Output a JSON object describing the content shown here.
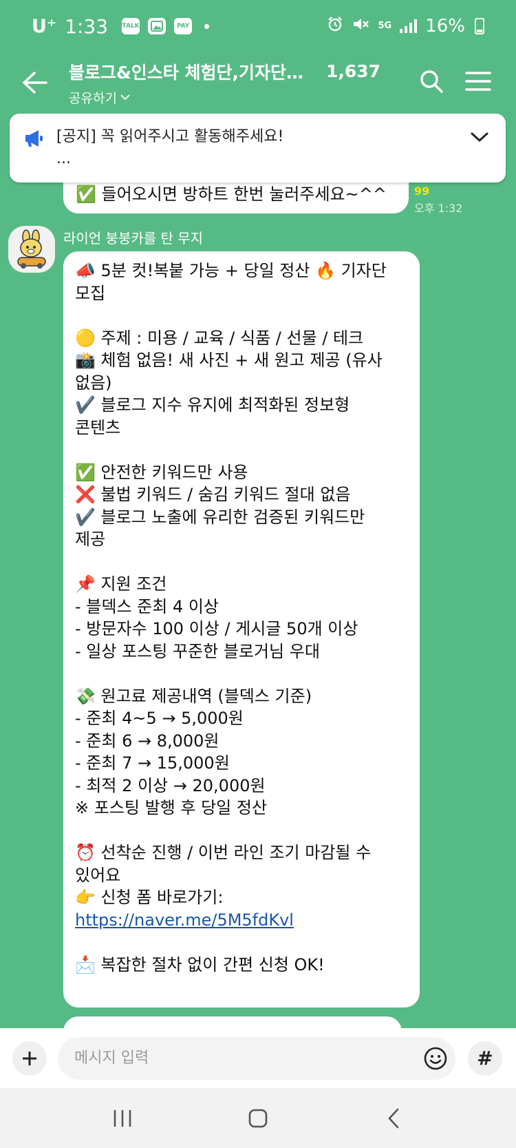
{
  "status_bar": {
    "carrier": "U⁺",
    "time": "1:33",
    "notif_icons": [
      "talk-icon",
      "gallery-icon",
      "pay-icon"
    ],
    "notif_talk_label": "TALK",
    "notif_pay_label": "PAY",
    "network": "5G",
    "battery": "16%"
  },
  "header": {
    "title": "블로그&인스타 체험단,기자단모집",
    "member_count": "1,637",
    "share_label": "공유하기"
  },
  "notice": {
    "text": "[공지] 꼭 읽어주시고 활동해주세요!",
    "ellipsis": "..."
  },
  "previous_message": {
    "text": "✅ 들어오시면 방하트 한번 눌러주세요~^^",
    "unread_count": "99",
    "time": "오후 1:32"
  },
  "sender": {
    "name": "라이언 붕붕카를 탄 무지"
  },
  "message": {
    "lines": [
      "📣 5분 컷!복붙 가능 + 당일 정산 🔥 기자단",
      "모집",
      "",
      "🟡 주제 : 미용 / 교육 / 식품 / 선물 / 테크",
      "📸 체험 없음! 새 사진 + 새 원고 제공 (유사",
      "없음)",
      "✔️ 블로그 지수 유지에 최적화된 정보형",
      "콘텐츠",
      "",
      "✅ 안전한 키워드만 사용",
      "❌ 불법 키워드 / 숨김 키워드 절대 없음",
      "✔️ 블로그 노출에 유리한 검증된 키워드만",
      "제공",
      "",
      "📌 지원 조건",
      "- 블덱스 준최 4 이상",
      "- 방문자수 100 이상 / 게시글 50개 이상",
      "- 일상 포스팅 꾸준한 블로거님 우대",
      "",
      "💸 원고료 제공내역 (블덱스 기준)",
      "- 준최 4~5 → 5,000원",
      "- 준최 6 → 8,000원",
      "- 준최 7 → 15,000원",
      "- 최적 2 이상 → 20,000원",
      "※ 포스팅 발행 후 당일 정산",
      "",
      "⏰ 선착순 진행 / 이번 라인 조기 마감될 수",
      "있어요",
      "👉 신청 폼 바로가기:"
    ],
    "link": "https://naver.me/5M5fdKvl",
    "footer_lines": [
      "",
      "📩 복잡한 절차 없이 간편 신청 OK!"
    ]
  },
  "input_bar": {
    "placeholder": "메시지 입력",
    "hash_label": "#"
  },
  "colors": {
    "chat_background": "#56BA84",
    "notice_icon": "#2F6EE6",
    "unread_badge": "#F6E400",
    "link": "#1A55B0"
  }
}
